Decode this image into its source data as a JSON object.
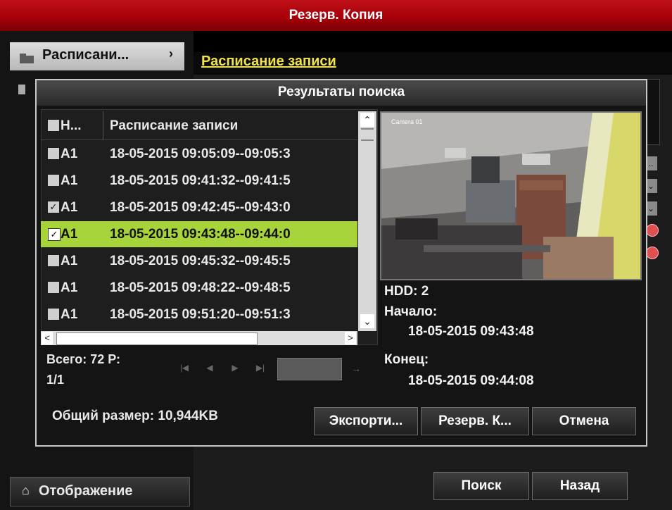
{
  "window": {
    "title": "Резерв. Копия"
  },
  "sidebar": {
    "item_label": "Расписани...",
    "home_label": "Отображение"
  },
  "tab": {
    "label": "Расписание записи"
  },
  "dialog": {
    "title": "Результаты поиска",
    "columns": [
      "Н...",
      "Расписание записи"
    ],
    "rows": [
      {
        "channel": "A1",
        "time": "18-05-2015 09:05:09--09:05:3",
        "checked": false
      },
      {
        "channel": "A1",
        "time": "18-05-2015 09:41:32--09:41:5",
        "checked": false
      },
      {
        "channel": "A1",
        "time": "18-05-2015 09:42:45--09:43:0",
        "checked": true
      },
      {
        "channel": "A1",
        "time": "18-05-2015 09:43:48--09:44:0",
        "checked": true,
        "selected": true
      },
      {
        "channel": "A1",
        "time": "18-05-2015 09:45:32--09:45:5",
        "checked": false
      },
      {
        "channel": "A1",
        "time": "18-05-2015 09:48:22--09:48:5",
        "checked": false
      },
      {
        "channel": "A1",
        "time": "18-05-2015 09:51:20--09:51:3",
        "checked": false
      }
    ],
    "pager": {
      "total_label": "Всего: 72  Р:",
      "page": "1/1"
    },
    "preview": {
      "camera_label": "Camera 01"
    },
    "info": {
      "hdd": "HDD: 2",
      "start_label": "Начало:",
      "start_value": "18-05-2015 09:43:48",
      "end_label": "Конец:",
      "end_value": "18-05-2015 09:44:08"
    },
    "total_size": "Общий размер: 10,944KB",
    "buttons": {
      "export": "Экспорти...",
      "backup": "Резерв. К...",
      "cancel": "Отмена"
    }
  },
  "footer": {
    "search": "Поиск",
    "back": "Назад"
  },
  "colors": {
    "title_bar": "#b0000c",
    "selection": "#a7d43a",
    "tab_text": "#f0e24a"
  }
}
